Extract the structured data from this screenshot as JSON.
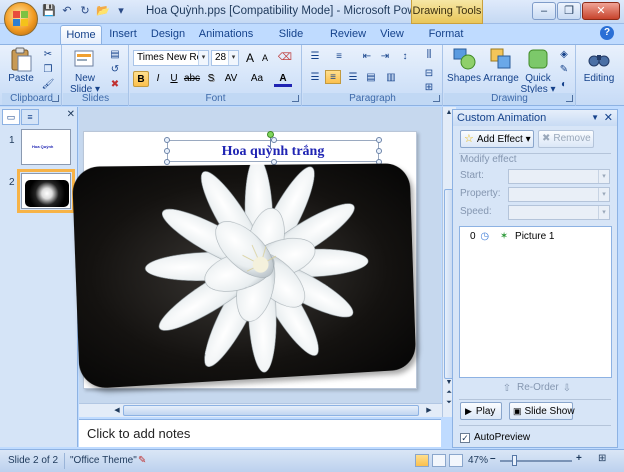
{
  "window": {
    "title": "Hoa Quỳnh.pps [Compatibility Mode] - Microsoft PowerPoint n...",
    "contextual_tab": "Drawing Tools",
    "minimize": "–",
    "maximize": "❐",
    "close": "✕"
  },
  "qat": {
    "save": "💾",
    "undo": "↶",
    "redo": "↻",
    "open": "📂",
    "dropdown": "▾"
  },
  "tabs": [
    "Home",
    "Insert",
    "Design",
    "Animations",
    "Slide Show",
    "Review",
    "View",
    "Format"
  ],
  "ribbon": {
    "groups": {
      "clipboard": "Clipboard",
      "slides": "Slides",
      "font": "Font",
      "paragraph": "Paragraph",
      "drawing": "Drawing"
    },
    "paste": "Paste",
    "new_slide": "New",
    "new_slide_2": "Slide ▾",
    "font_name": "Times New Roma",
    "font_size": "28",
    "grow": "A",
    "shrink": "A",
    "clear": "⌫",
    "bold": "B",
    "italic": "I",
    "underline": "U",
    "strike": "abc",
    "shadow": "S",
    "spacing": "AV",
    "case": "Aa",
    "color": "A",
    "shapes": "Shapes",
    "arrange": "Arrange",
    "quick_styles": "Quick",
    "quick_styles_2": "Styles ▾",
    "editing": "Editing"
  },
  "slides_pane": {
    "thumbs": [
      {
        "num": "1",
        "text": "Hoa Quỳnh"
      },
      {
        "num": "2"
      }
    ]
  },
  "slide": {
    "title": "Hoa quỳnh trắng"
  },
  "notes": {
    "placeholder": "Click to add notes"
  },
  "custom_animation": {
    "header": "Custom Animation",
    "add_effect": "Add Effect ▾",
    "remove": "Remove",
    "modify_effect": "Modify effect",
    "start": "Start:",
    "property": "Property:",
    "speed": "Speed:",
    "item_index": "0",
    "item_name": "Picture 1",
    "reorder": "Re-Order",
    "play": "Play",
    "slide_show": "Slide Show",
    "autopreview": "AutoPreview",
    "autopreview_checked": "✓"
  },
  "status": {
    "slide": "Slide 2 of 2",
    "theme": "\"Office Theme\"",
    "zoom": "47%",
    "zoom_minus": "–",
    "zoom_plus": "+"
  },
  "colors": {
    "ribbon_bg": "#d4e4f9",
    "accent": "#f7b347",
    "title_color": "#1f24b3"
  }
}
